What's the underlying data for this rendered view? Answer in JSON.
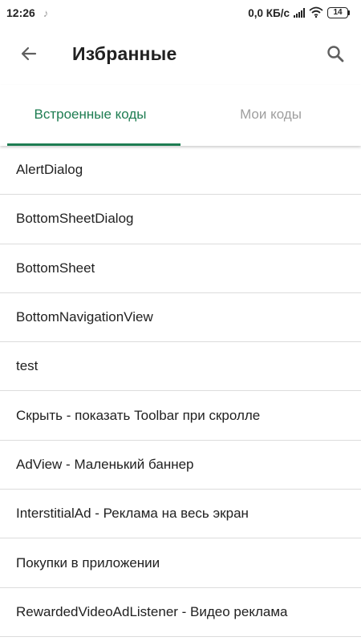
{
  "status_bar": {
    "time": "12:26",
    "net_speed": "0,0 КБ/с",
    "battery": "14"
  },
  "app_bar": {
    "title": "Избранные"
  },
  "tabs": [
    {
      "label": "Встроенные коды",
      "selected": true
    },
    {
      "label": "Мои коды",
      "selected": false
    }
  ],
  "colors": {
    "accent": "#1e7d52",
    "inactive_tab": "#9e9e9e"
  },
  "list": {
    "items": [
      "AlertDialog",
      "BottomSheetDialog",
      "BottomSheet",
      "BottomNavigationView",
      "test",
      "Скрыть - показать Toolbar при скролле",
      "AdView - Маленький баннер",
      "InterstitialAd - Реклама на весь экран",
      "Покупки в приложении",
      "RewardedVideoAdListener - Видео реклама"
    ]
  }
}
